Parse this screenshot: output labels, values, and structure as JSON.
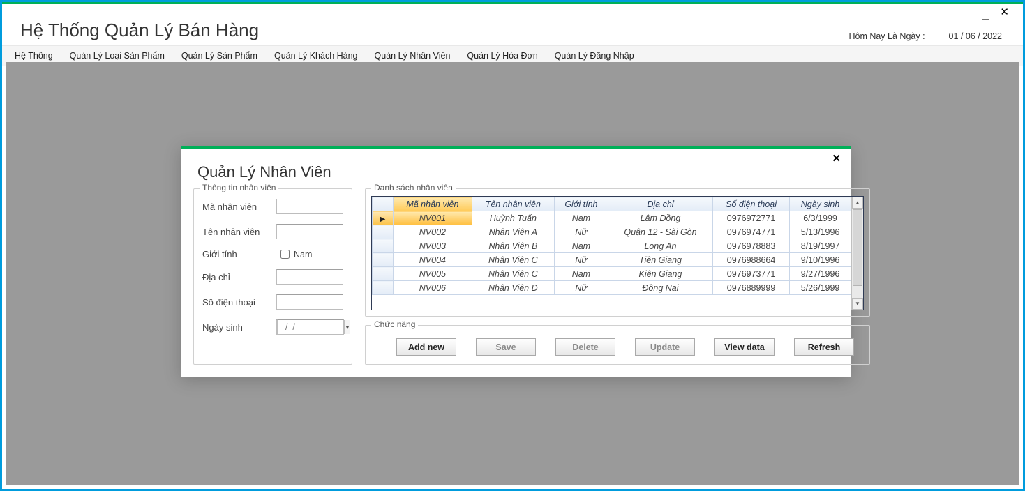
{
  "window": {
    "app_title": "Hệ Thống Quản Lý Bán Hàng",
    "date_label": "Hôm Nay Là Ngày :",
    "date_value": "01 / 06 / 2022"
  },
  "menu": {
    "items": [
      "Hệ Thống",
      "Quản Lý Loại Sản Phẩm",
      "Quản Lý Sản Phẩm",
      "Quản Lý Khách Hàng",
      "Quản Lý Nhân Viên",
      "Quản Lý Hóa Đơn",
      "Quản Lý Đăng Nhập"
    ]
  },
  "child": {
    "title": "Quản Lý Nhân Viên",
    "group_info": "Thông tin nhân viên",
    "group_list": "Danh sách nhân viên",
    "group_func": "Chức năng",
    "form": {
      "ma_label": "Mã nhân viên",
      "ten_label": "Tên nhân viên",
      "gioi_label": "Giới tính",
      "gioi_checkbox": "Nam",
      "diachi_label": "Địa chỉ",
      "sdt_label": "Số điện thoại",
      "ngaysinh_label": "Ngày sinh",
      "ngaysinh_value": "  /  /"
    },
    "table": {
      "columns": [
        "Mã nhân viên",
        "Tên nhân viên",
        "Giới tính",
        "Địa chỉ",
        "Số điện thoại",
        "Ngày sinh"
      ],
      "rows": [
        {
          "ma": "NV001",
          "ten": "Huỳnh Tuấn",
          "gioi": "Nam",
          "diachi": "Lâm Đồng",
          "sdt": "0976972771",
          "ns": "6/3/1999"
        },
        {
          "ma": "NV002",
          "ten": "Nhân Viên A",
          "gioi": "Nữ",
          "diachi": "Quận 12 - Sài Gòn",
          "sdt": "0976974771",
          "ns": "5/13/1996"
        },
        {
          "ma": "NV003",
          "ten": "Nhân Viên B",
          "gioi": "Nam",
          "diachi": "Long An",
          "sdt": "0976978883",
          "ns": "8/19/1997"
        },
        {
          "ma": "NV004",
          "ten": "Nhân Viên C",
          "gioi": "Nữ",
          "diachi": "Tiền Giang",
          "sdt": "0976988664",
          "ns": "9/10/1996"
        },
        {
          "ma": "NV005",
          "ten": "Nhân Viên C",
          "gioi": "Nam",
          "diachi": "Kiên Giang",
          "sdt": "0976973771",
          "ns": "9/27/1996"
        },
        {
          "ma": "NV006",
          "ten": "Nhân Viên D",
          "gioi": "Nữ",
          "diachi": "Đồng Nai",
          "sdt": "0976889999",
          "ns": "5/26/1999"
        }
      ],
      "selected_index": 0
    },
    "buttons": {
      "add": "Add new",
      "save": "Save",
      "delete": "Delete",
      "update": "Update",
      "view": "View data",
      "refresh": "Refresh"
    }
  }
}
